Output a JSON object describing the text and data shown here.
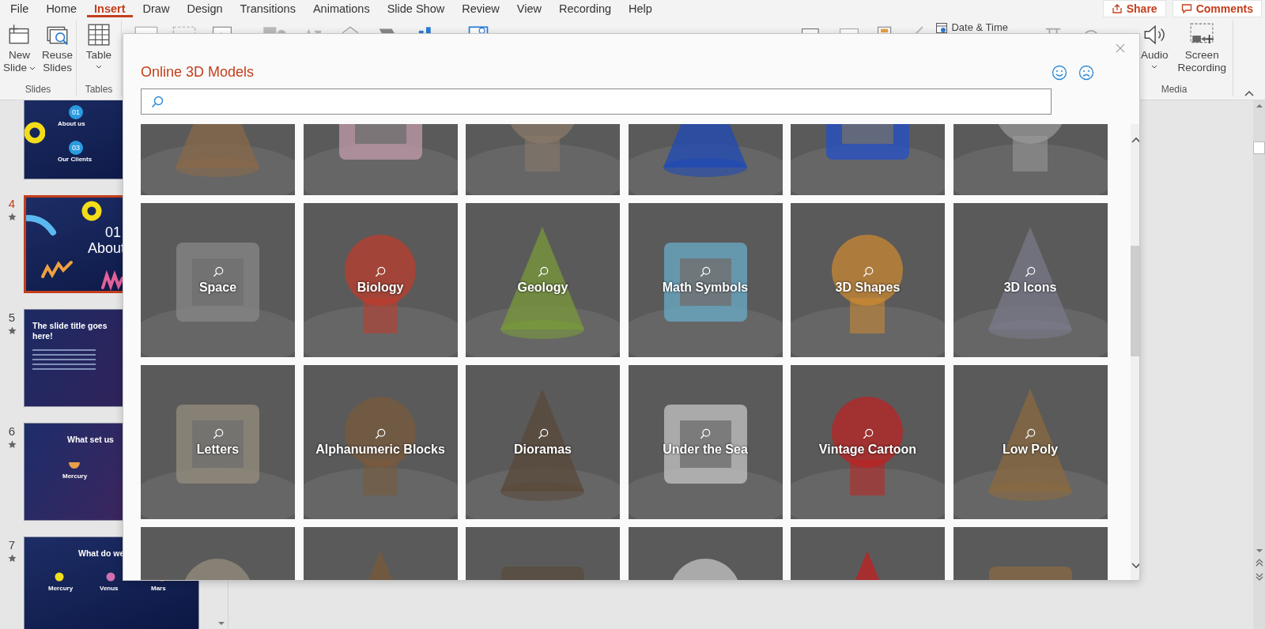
{
  "menu_tabs": [
    {
      "label": "File",
      "selected": false
    },
    {
      "label": "Home",
      "selected": false
    },
    {
      "label": "Insert",
      "selected": true
    },
    {
      "label": "Draw",
      "selected": false
    },
    {
      "label": "Design",
      "selected": false
    },
    {
      "label": "Transitions",
      "selected": false
    },
    {
      "label": "Animations",
      "selected": false
    },
    {
      "label": "Slide Show",
      "selected": false
    },
    {
      "label": "Review",
      "selected": false
    },
    {
      "label": "View",
      "selected": false
    },
    {
      "label": "Recording",
      "selected": false
    },
    {
      "label": "Help",
      "selected": false
    }
  ],
  "share_button": "Share",
  "comments_button": "Comments",
  "ribbon": {
    "slides_group": {
      "label": "Slides",
      "new_slide": [
        "New",
        "Slide"
      ],
      "reuse_slides": [
        "Reuse",
        "Slides"
      ]
    },
    "tables_group": {
      "label": "Tables",
      "table": "Table"
    },
    "date_time": "Date & Time",
    "media_group": {
      "label": "Media",
      "audio": "Audio",
      "screen_recording": [
        "Screen",
        "Recording"
      ]
    }
  },
  "slides": [
    {
      "kind": "toc",
      "selected": false,
      "items": [
        {
          "badge": "01",
          "label": "About us"
        },
        {
          "badge": "03",
          "label": "Our Clients"
        }
      ]
    },
    {
      "kind": "section",
      "number": "4",
      "animated": true,
      "selected": true,
      "badge": "01",
      "title": "About"
    },
    {
      "kind": "text",
      "number": "5",
      "animated": true,
      "selected": false,
      "title": "The slide title goes here!"
    },
    {
      "kind": "single",
      "number": "6",
      "animated": true,
      "selected": false,
      "title": "What set us",
      "items": [
        {
          "label": "Mercury"
        }
      ]
    },
    {
      "kind": "triple",
      "number": "7",
      "animated": true,
      "selected": false,
      "title": "What do we",
      "items": [
        {
          "label": "Mercury"
        },
        {
          "label": "Venus"
        },
        {
          "label": "Mars"
        }
      ]
    }
  ],
  "dialog": {
    "title": "Online 3D Models",
    "categories": [
      {
        "label": "Space"
      },
      {
        "label": "Biology"
      },
      {
        "label": "Geology"
      },
      {
        "label": "Math Symbols"
      },
      {
        "label": "3D Shapes"
      },
      {
        "label": "3D Icons"
      },
      {
        "label": "Letters"
      },
      {
        "label": "Alphanumeric Blocks"
      },
      {
        "label": "Dioramas"
      },
      {
        "label": "Under the Sea"
      },
      {
        "label": "Vintage Cartoon"
      },
      {
        "label": "Low Poly"
      }
    ]
  }
}
